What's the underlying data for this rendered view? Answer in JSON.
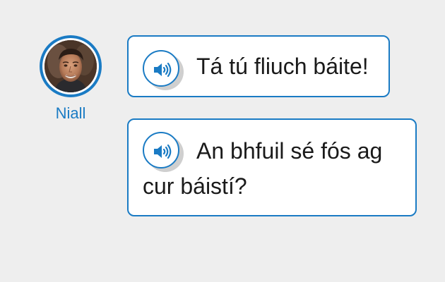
{
  "speaker": {
    "name": "Niall"
  },
  "messages": [
    {
      "text": "Tá tú fliuch báite!",
      "audio_icon": "speaker-icon"
    },
    {
      "text": "An bhfuil sé fós ag cur báistí?",
      "audio_icon": "speaker-icon"
    }
  ],
  "colors": {
    "accent": "#1a7bc4",
    "background": "#eeeeee",
    "bubble_background": "#ffffff",
    "text": "#1a1a1a"
  }
}
